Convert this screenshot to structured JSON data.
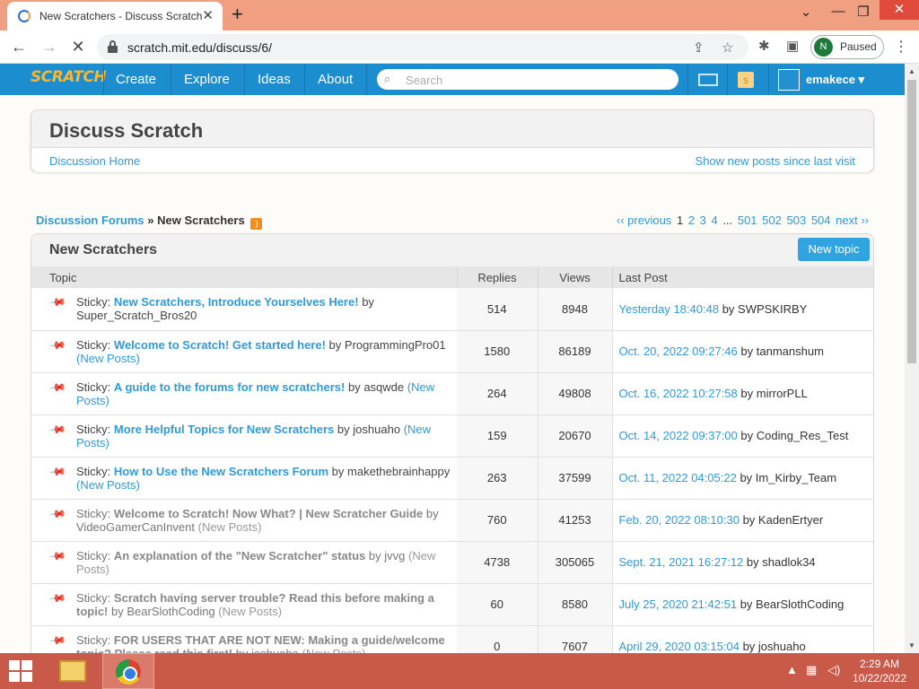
{
  "browser": {
    "tab_title": "New Scratchers - Discuss Scratch",
    "tab_close": "✕",
    "new_tab": "+",
    "url": "scratch.mit.edu/discuss/6/",
    "profile_initial": "N",
    "profile_status": "Paused",
    "window_controls": {
      "minimize": "⌄",
      "restore": "—",
      "maximize": "❐",
      "close": "✕"
    }
  },
  "scratch_nav": {
    "logo": "SCRATCH",
    "links": [
      "Create",
      "Explore",
      "Ideas",
      "About"
    ],
    "search_placeholder": "Search",
    "username": "emakece ▾"
  },
  "discuss": {
    "title": "Discuss Scratch",
    "home_link": "Discussion Home",
    "new_posts_link": "Show new posts since last visit"
  },
  "breadcrumb": {
    "root": "Discussion Forums",
    "separator": "»",
    "current": "New Scratchers"
  },
  "pagination": {
    "previous": "‹‹ previous",
    "current": "1",
    "pages": [
      "2",
      "3",
      "4"
    ],
    "ellipsis": "...",
    "tail_pages": [
      "501",
      "502",
      "503",
      "504"
    ],
    "next": "next ››"
  },
  "forum": {
    "title": "New Scratchers",
    "new_topic_button": "New topic",
    "columns": [
      "Topic",
      "Replies",
      "Views",
      "Last Post"
    ],
    "topics": [
      {
        "prefix": "Sticky:",
        "title": "New Scratchers, Introduce Yourselves Here!",
        "by": "by",
        "author": "Super_Scratch_Bros20",
        "new_posts": "",
        "replies": "514",
        "views": "8948",
        "last_post_date": "Yesterday 18:40:48",
        "last_post_by": "by SWPSKIRBY",
        "visited": false
      },
      {
        "prefix": "Sticky:",
        "title": "Welcome to Scratch! Get started here!",
        "by": "by",
        "author": "ProgrammingPro01",
        "new_posts": "(New Posts)",
        "replies": "1580",
        "views": "86189",
        "last_post_date": "Oct. 20, 2022 09:27:46",
        "last_post_by": "by tanmanshum",
        "visited": false
      },
      {
        "prefix": "Sticky:",
        "title": "A guide to the forums for new scratchers!",
        "by": "by",
        "author": "asqwde",
        "new_posts": "(New Posts)",
        "replies": "264",
        "views": "49808",
        "last_post_date": "Oct. 16, 2022 10:27:58",
        "last_post_by": "by mirrorPLL",
        "visited": false
      },
      {
        "prefix": "Sticky:",
        "title": "More Helpful Topics for New Scratchers",
        "by": "by",
        "author": "joshuaho",
        "new_posts": "(New Posts)",
        "replies": "159",
        "views": "20670",
        "last_post_date": "Oct. 14, 2022 09:37:00",
        "last_post_by": "by Coding_Res_Test",
        "visited": false
      },
      {
        "prefix": "Sticky:",
        "title": "How to Use the New Scratchers Forum",
        "by": "by",
        "author": "makethebrainhappy",
        "new_posts": "(New Posts)",
        "replies": "263",
        "views": "37599",
        "last_post_date": "Oct. 11, 2022 04:05:22",
        "last_post_by": "by Im_Kirby_Team",
        "visited": false
      },
      {
        "prefix": "Sticky:",
        "title": "Welcome to Scratch! Now What? | New Scratcher Guide",
        "by": "by",
        "author": "VideoGamerCanInvent",
        "new_posts": "(New Posts)",
        "replies": "760",
        "views": "41253",
        "last_post_date": "Feb. 20, 2022 08:10:30",
        "last_post_by": "by KadenErtyer",
        "visited": true
      },
      {
        "prefix": "Sticky:",
        "title": "An explanation of the \"New Scratcher\" status",
        "by": "by",
        "author": "jvvg",
        "new_posts": "(New Posts)",
        "replies": "4738",
        "views": "305065",
        "last_post_date": "Sept. 21, 2021 16:27:12",
        "last_post_by": "by shadlok34",
        "visited": true
      },
      {
        "prefix": "Sticky:",
        "title": "Scratch having server trouble? Read this before making a topic!",
        "by": "by",
        "author": "BearSlothCoding",
        "new_posts": "(New Posts)",
        "replies": "60",
        "views": "8580",
        "last_post_date": "July 25, 2020 21:42:51",
        "last_post_by": "by BearSlothCoding",
        "visited": true
      },
      {
        "prefix": "Sticky:",
        "title": "FOR USERS THAT ARE NOT NEW: Making a guide/welcome topic? Please read this first!",
        "by": "by",
        "author": "joshuaho",
        "new_posts": "(New Posts)",
        "replies": "0",
        "views": "7607",
        "last_post_date": "April 29, 2020 03:15:04",
        "last_post_by": "by joshuaho",
        "visited": true
      }
    ]
  },
  "taskbar": {
    "time": "2:29 AM",
    "date": "10/22/2022"
  },
  "colors": {
    "scratch_blue": "#1c8ecf",
    "link_blue": "#2f9ad7",
    "tab_strip": "#f0a080",
    "taskbar": "#c95a4a"
  }
}
